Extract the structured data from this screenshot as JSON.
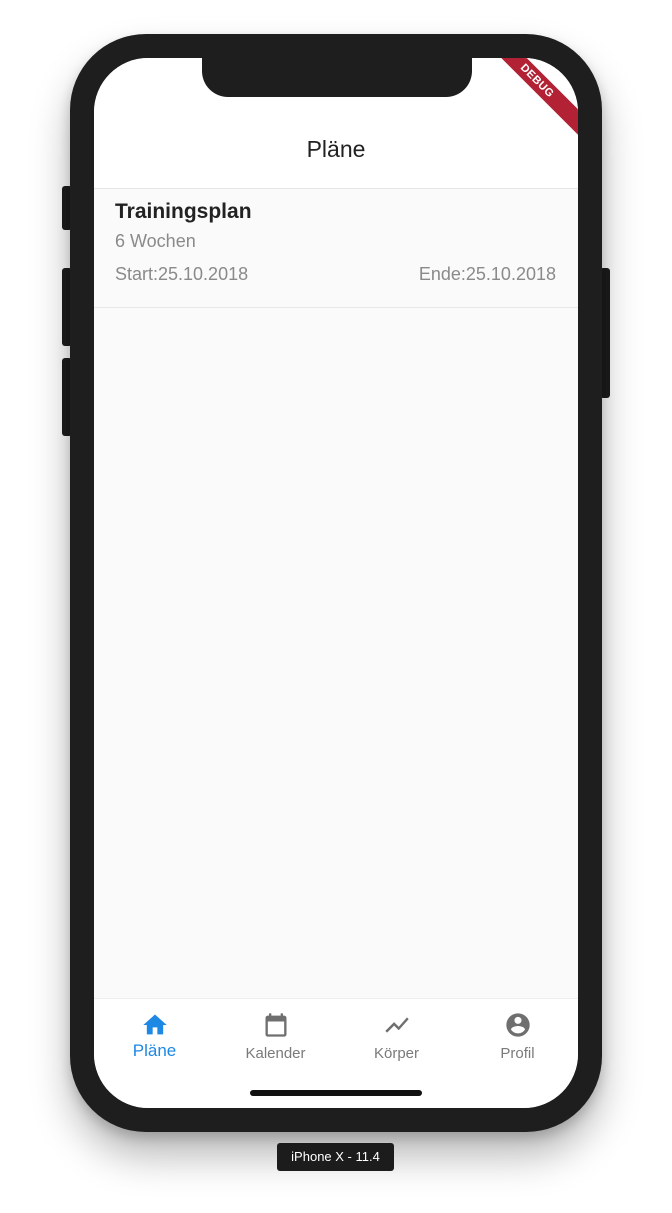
{
  "debug_banner": "DEBUG",
  "appbar": {
    "title": "Pläne"
  },
  "plans": [
    {
      "name": "Trainingsplan",
      "duration": "6 Wochen",
      "start": "Start:25.10.2018",
      "end": "Ende:25.10.2018"
    }
  ],
  "bottom_nav": {
    "items": [
      {
        "label": "Pläne",
        "icon": "home-icon",
        "active": true
      },
      {
        "label": "Kalender",
        "icon": "calendar-icon",
        "active": false
      },
      {
        "label": "Körper",
        "icon": "trending-up-icon",
        "active": false
      },
      {
        "label": "Profil",
        "icon": "account-circle-icon",
        "active": false
      }
    ]
  },
  "device_label": "iPhone X - 11.4",
  "colors": {
    "accent": "#1e88e5",
    "debug_banner": "#b22234",
    "inactive_icon": "#6f6f6f"
  }
}
